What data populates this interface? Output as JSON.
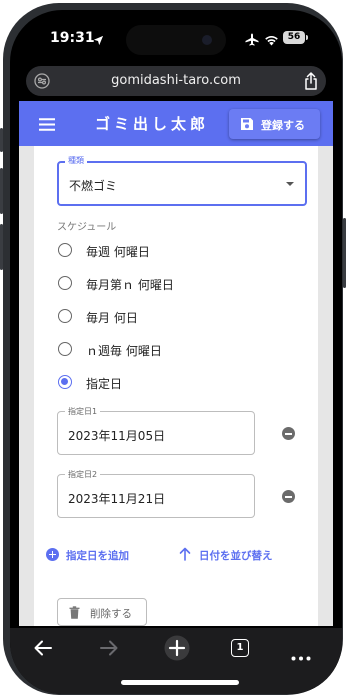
{
  "status_bar": {
    "time": "19:31",
    "battery": "56"
  },
  "browser": {
    "url": "gomidashi-taro.com",
    "tab_count": "1"
  },
  "app": {
    "title": "ゴミ出し太郎",
    "register_label": "登録する"
  },
  "form": {
    "type_label": "種類",
    "type_value": "不燃ゴミ",
    "schedule_label": "スケジュール",
    "schedule_options": [
      {
        "label": "毎週 何曜日",
        "checked": false
      },
      {
        "label": "毎月第ｎ 何曜日",
        "checked": false
      },
      {
        "label": "毎月 何日",
        "checked": false
      },
      {
        "label": "ｎ週毎 何曜日",
        "checked": false
      },
      {
        "label": "指定日",
        "checked": true
      }
    ],
    "dates": [
      {
        "label": "指定日1",
        "value": "2023年11月05日"
      },
      {
        "label": "指定日2",
        "value": "2023年11月21日"
      }
    ],
    "add_date_label": "指定日を追加",
    "sort_label": "日付を並び替え",
    "delete_label": "削除する"
  },
  "colors": {
    "accent": "#5c6ff0",
    "toolbar": "#1c1c1e"
  },
  "icons": [
    "location-arrow-icon",
    "airplane-icon",
    "wifi-icon",
    "site-settings-icon",
    "share-icon",
    "menu-icon",
    "save-icon",
    "remove-circle-icon",
    "add-circle-icon",
    "arrow-up-icon",
    "trash-icon",
    "back-arrow-icon",
    "forward-arrow-icon",
    "new-tab-plus-icon",
    "tabs-icon",
    "more-icon"
  ]
}
